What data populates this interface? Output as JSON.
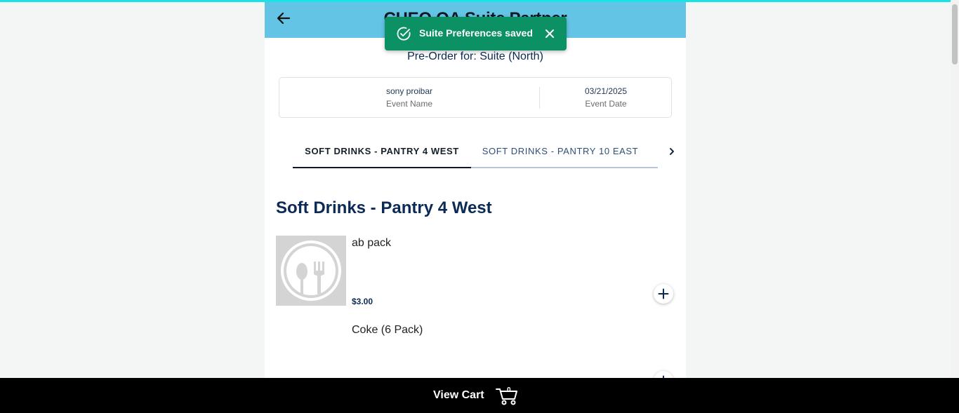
{
  "app": {
    "title": "CHEQ QA Suite Partner"
  },
  "toast": {
    "message": "Suite Preferences saved"
  },
  "preorder": {
    "text": "Pre-Order for: Suite (North)"
  },
  "event": {
    "name_value": "sony proibar",
    "name_label": "Event Name",
    "date_value": "03/21/2025",
    "date_label": "Event Date"
  },
  "tabs": [
    {
      "label": "SOFT DRINKS - PANTRY 4 WEST",
      "active": true
    },
    {
      "label": "SOFT DRINKS - PANTRY 10 EAST",
      "active": false
    }
  ],
  "section": {
    "title": "Soft Drinks - Pantry 4 West"
  },
  "items": [
    {
      "name": "ab pack",
      "price": "$3.00",
      "image": "placeholder-utensils-icon"
    },
    {
      "name": "Coke (6 Pack)"
    }
  ],
  "cart": {
    "label": "View Cart",
    "count": "0"
  },
  "colors": {
    "header": "#63c4e6",
    "toast": "#0c9164",
    "heading": "#0b2a55",
    "cart_bar": "#000000"
  }
}
